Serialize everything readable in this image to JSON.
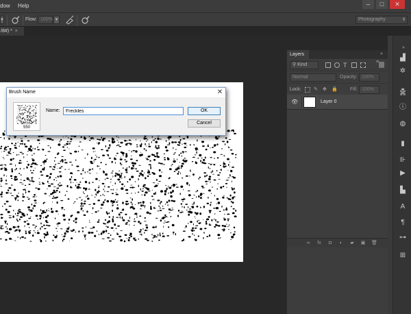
{
  "menubar": {
    "items": [
      "dow",
      "Help"
    ],
    "window_controls": [
      "–",
      "□",
      "✕"
    ]
  },
  "options_bar": {
    "flow_label": "Flow:",
    "flow_value": "100%",
    "workspace": "Photography",
    "icons": [
      "brush-tool-icon",
      "airbrush-icon",
      "pressure-icon"
    ]
  },
  "document": {
    "tab_label": "/8#) *",
    "tab_close": "×"
  },
  "layers_panel": {
    "title": "Layers",
    "kind_label": "Kind",
    "blend_mode": "Normal",
    "opacity_label": "Opacity:",
    "opacity_value": "100%",
    "lock_label": "Lock:",
    "fill_label": "Fill:",
    "fill_value": "100%",
    "layer_name": "Layer 0",
    "footer_icons": [
      "link-icon",
      "fx-icon",
      "mask-icon",
      "adjustment-icon",
      "folder-icon",
      "new-layer-icon",
      "trash-icon"
    ]
  },
  "dialog": {
    "title": "Brush Name",
    "close": "✕",
    "brush_size": "550",
    "name_label": "Name:",
    "name_value": "Freckles",
    "ok_label": "OK",
    "cancel_label": "Cancel"
  },
  "dock_icons": [
    "histogram-icon",
    "navigator-icon",
    "info-icon",
    "color-icon",
    "swatches-icon",
    "info-circle-icon",
    "adjustments-icon",
    "styles-icon",
    "brush-presets-icon",
    "actions-icon",
    "play-icon",
    "properties-icon",
    "character-icon",
    "paragraph-icon",
    "clone-source-icon",
    "tool-presets-icon",
    "paths-icon"
  ],
  "colors": {
    "bg": "#282828",
    "panel": "#3d3d3d",
    "accent": "#4a90d9"
  }
}
